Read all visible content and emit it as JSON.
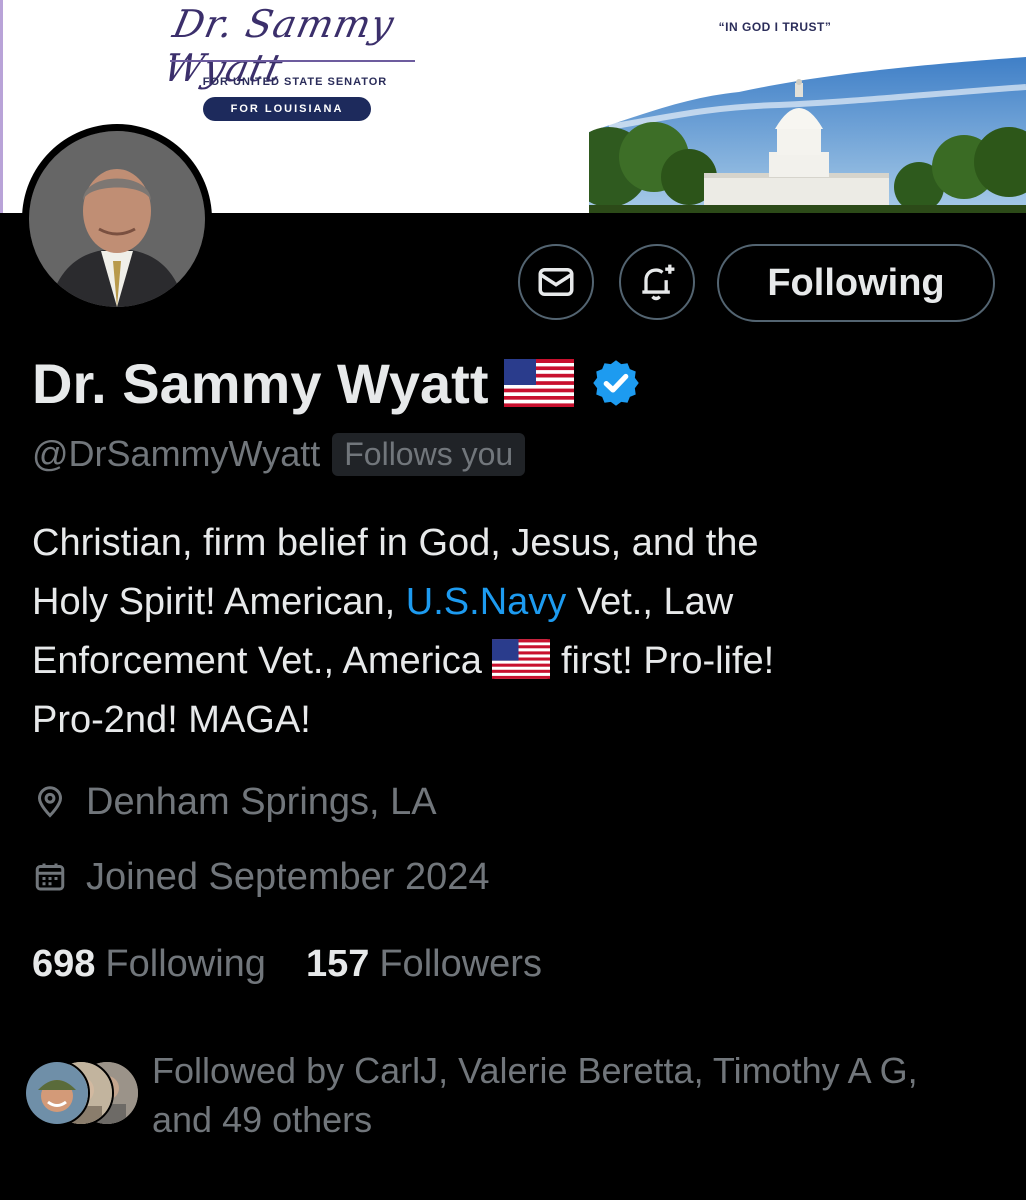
{
  "banner": {
    "signature": "Dr. Sammy Wyatt",
    "subtitle": "FOR UNITED STATE SENATOR",
    "state_pill": "FOR LOUISIANA",
    "motto": "“IN GOD I TRUST”"
  },
  "actions": {
    "follow_label": "Following"
  },
  "profile": {
    "display_name": "Dr. Sammy Wyatt",
    "handle": "@DrSammyWyatt",
    "follows_you": "Follows you",
    "bio": {
      "line1": "Christian, firm belief in God, Jesus, and the",
      "line2_a": "Holy Spirit! American, ",
      "line2_link": "U.S.Navy",
      "line2_b": " Vet., Law",
      "line3_a": "Enforcement Vet., America ",
      "line3_b": " first! Pro-life!",
      "line4": "Pro-2nd! MAGA!"
    },
    "location": "Denham Springs, LA",
    "joined": "Joined September 2024"
  },
  "stats": {
    "following_count": "698",
    "following_label": "Following",
    "followers_count": "157",
    "followers_label": "Followers"
  },
  "followed_by": {
    "line1": "Followed by CarlJ, Valerie Beretta, Timothy A G,",
    "line2": "and 49 others"
  },
  "colors": {
    "background": "#000000",
    "text_primary": "#e7e9ea",
    "text_secondary": "#71767b",
    "link": "#1d9bf0",
    "verified": "#1d9bf0",
    "border": "#536471"
  },
  "icons": [
    "mail-icon",
    "bell-plus-icon",
    "verified-badge-icon",
    "us-flag-icon",
    "location-pin-icon",
    "calendar-icon"
  ]
}
